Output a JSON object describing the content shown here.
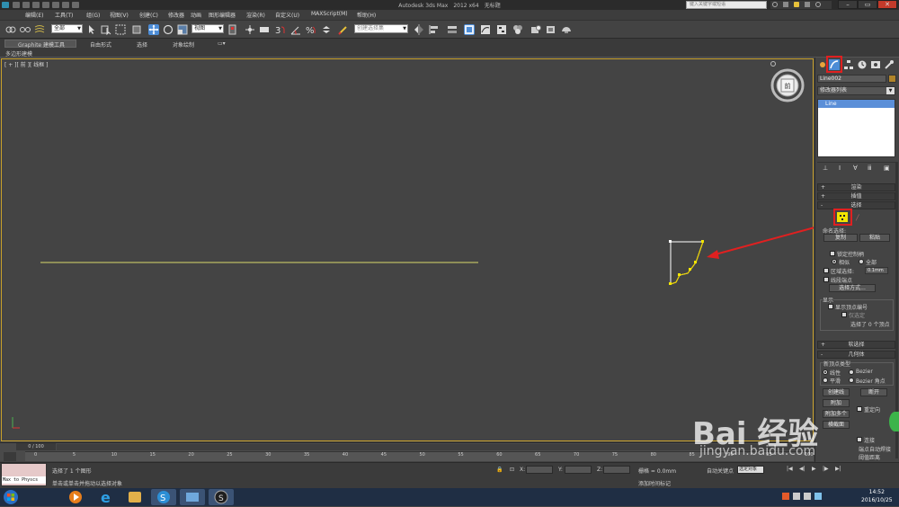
{
  "titlebar": {
    "app": "Autodesk 3ds Max",
    "version": "2012 x64",
    "file": "无标题",
    "search_placeholder": "键入关键字或短语",
    "minimize": "–",
    "restore": "▭",
    "close": "✕"
  },
  "menu": [
    "编辑(E)",
    "工具(T)",
    "组(G)",
    "视图(V)",
    "创建(C)",
    "修改器",
    "动画",
    "图形编辑器",
    "渲染(R)",
    "自定义(U)",
    "MAXScript(M)",
    "帮助(H)"
  ],
  "toolbar": {
    "selection_filter": "全部",
    "reference_coord": "视图",
    "named_selection": "创建选择集"
  },
  "ribbon": {
    "tabs": [
      "Graphite 建模工具",
      "自由形式",
      "选择",
      "对象绘制"
    ],
    "subtab": "多边形建模"
  },
  "viewport": {
    "label": "[ + ][ 前 ][ 线框 ]",
    "viewcube_face": "前"
  },
  "cmdpanel": {
    "object_name": "Line002",
    "modifier_list": "修改器列表",
    "stack_item": "Line",
    "rollouts": {
      "rendering": "渲染",
      "interpolation": "插值",
      "selection": "选择",
      "soft_selection": "软选择",
      "geometry": "几何体"
    },
    "selection": {
      "named_selections": "命名选择:",
      "copy": "复制",
      "paste": "粘贴",
      "lock_handles": "锁定控制柄",
      "alike": "相似",
      "all": "全部",
      "area_selection": "区域选择:",
      "area_value": "0.1mm",
      "segment_end": "线段端点",
      "select_by": "选择方式...",
      "display": "显示",
      "show_vertex_numbers": "显示顶点编号",
      "selected_only": "仅选定",
      "selected_count": "选择了 0 个顶点"
    },
    "geometry": {
      "new_vertex_type": "新顶点类型",
      "linear": "线性",
      "bezier": "Bezier",
      "smooth": "平滑",
      "bezier_corner": "Bezier 角点",
      "create_line": "创建线",
      "break": "断开",
      "attach": "附加",
      "attach_multiple": "附加多个",
      "reorient": "重定向",
      "cross_section": "横截面",
      "connect": "连接",
      "auto_weld": "端点自动焊接",
      "threshold": "阈值距离"
    }
  },
  "timeline": {
    "frame": "0 / 100",
    "ticks": [
      "0",
      "5",
      "10",
      "15",
      "20",
      "25",
      "30",
      "35",
      "40",
      "45",
      "50",
      "55",
      "60",
      "65",
      "70",
      "75",
      "80",
      "85",
      "90",
      "95",
      "100"
    ]
  },
  "status": {
    "selected": "选择了 1 个图形",
    "prompt": "单击或单击并拖动以选择对象",
    "physics": "Max to Physcs",
    "x_label": "X:",
    "y_label": "Y:",
    "z_label": "Z:",
    "grid": "栅格 = 0.0mm",
    "auto_key": "自动关键点",
    "set_key": "选定对象",
    "add_time_tag": "添加时间标记"
  },
  "taskbar": {
    "time": "14:52",
    "date": "2016/10/25"
  },
  "watermark": {
    "brand": "Bai  经验",
    "url": "jingyan.baidu.com"
  },
  "colors": {
    "accent_red": "#e02020",
    "highlight_yellow": "#f2e600",
    "viewport_border": "#c8a02a",
    "selection_blue": "#5b8fd8"
  }
}
